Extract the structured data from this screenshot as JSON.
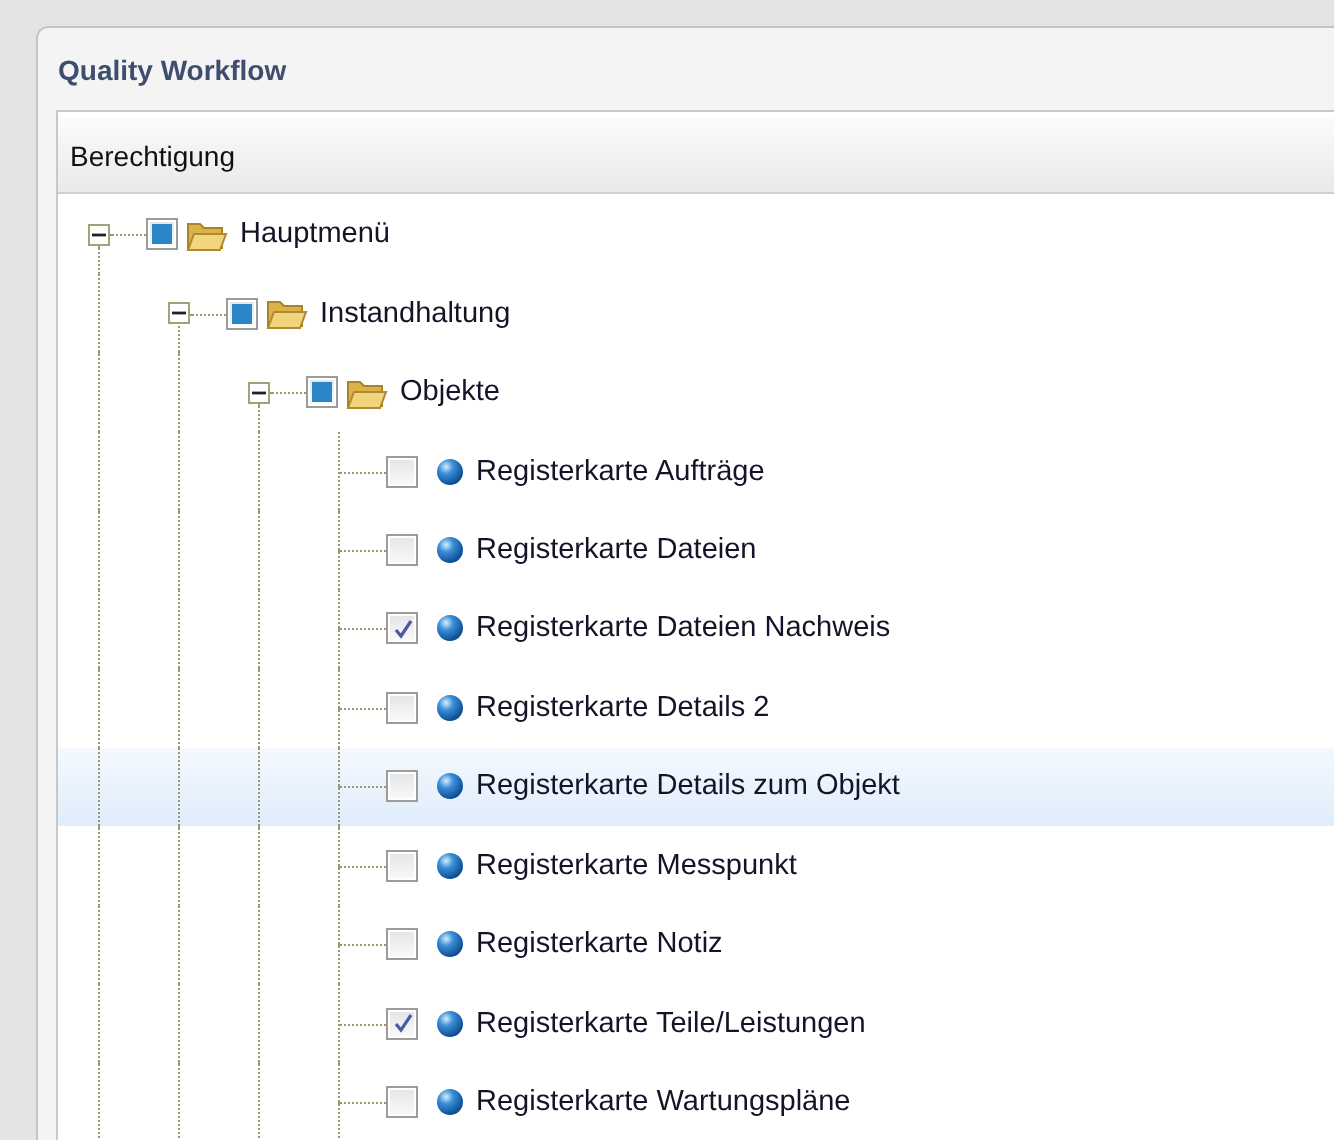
{
  "window": {
    "title": "Quality Workflow"
  },
  "panel": {
    "title": "Berechtigung"
  },
  "tree": [
    {
      "label": "Hauptmenü",
      "kind": "folder",
      "checked": false,
      "partial": true,
      "expanded": true,
      "selected": false,
      "children": [
        {
          "label": "Instandhaltung",
          "kind": "folder",
          "checked": false,
          "partial": true,
          "expanded": true,
          "selected": false,
          "children": [
            {
              "label": "Objekte",
              "kind": "folder",
              "checked": false,
              "partial": true,
              "expanded": true,
              "selected": false,
              "children": [
                {
                  "label": "Registerkarte Aufträge",
                  "kind": "item",
                  "checked": false,
                  "selected": false
                },
                {
                  "label": "Registerkarte Dateien",
                  "kind": "item",
                  "checked": false,
                  "selected": false
                },
                {
                  "label": "Registerkarte Dateien Nachweis",
                  "kind": "item",
                  "checked": true,
                  "selected": false
                },
                {
                  "label": "Registerkarte Details 2",
                  "kind": "item",
                  "checked": false,
                  "selected": false
                },
                {
                  "label": "Registerkarte Details zum Objekt",
                  "kind": "item",
                  "checked": false,
                  "selected": true
                },
                {
                  "label": "Registerkarte Messpunkt",
                  "kind": "item",
                  "checked": false,
                  "selected": false
                },
                {
                  "label": "Registerkarte Notiz",
                  "kind": "item",
                  "checked": false,
                  "selected": false
                },
                {
                  "label": "Registerkarte Teile/Leistungen",
                  "kind": "item",
                  "checked": true,
                  "selected": false
                },
                {
                  "label": "Registerkarte Wartungspläne",
                  "kind": "item",
                  "checked": false,
                  "selected": false
                }
              ]
            }
          ]
        }
      ]
    }
  ]
}
